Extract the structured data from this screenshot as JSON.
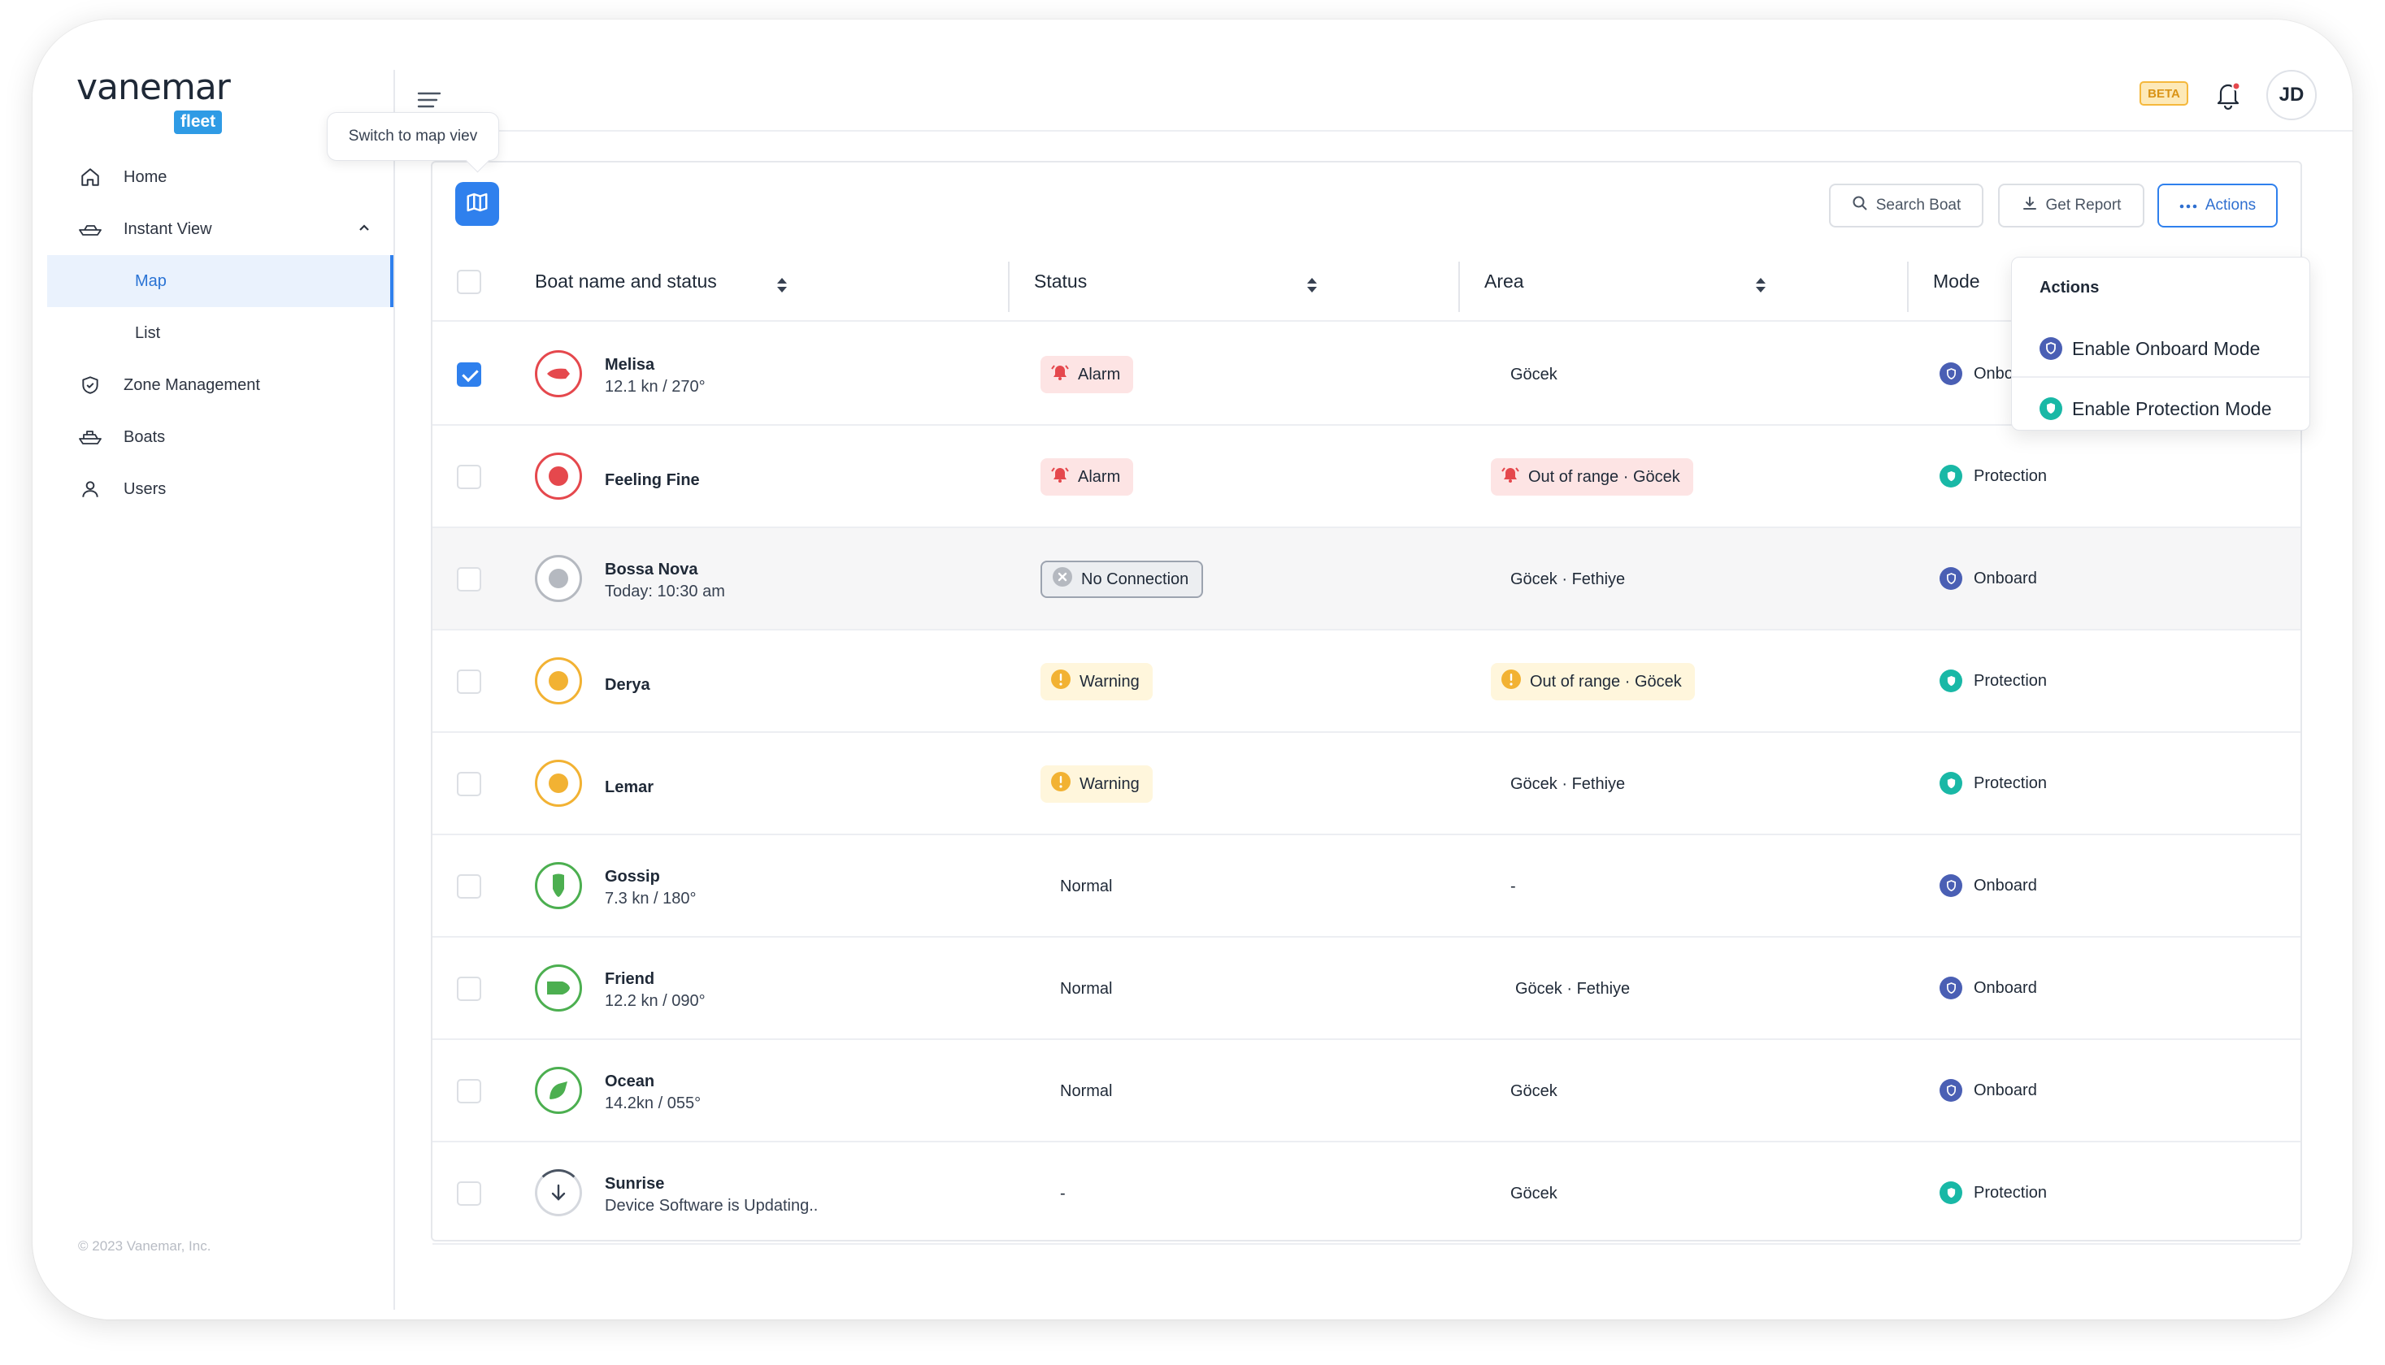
{
  "brand": {
    "name": "vanemar",
    "badge": "fleet"
  },
  "sidebar": {
    "items": [
      {
        "label": "Home",
        "icon": "home-icon"
      },
      {
        "label": "Instant View",
        "icon": "boat-icon",
        "expanded": true,
        "children": [
          {
            "label": "Map",
            "active": true
          },
          {
            "label": "List",
            "active": false
          }
        ]
      },
      {
        "label": "Zone Management",
        "icon": "shield-icon"
      },
      {
        "label": "Boats",
        "icon": "ship-icon"
      },
      {
        "label": "Users",
        "icon": "user-icon"
      }
    ],
    "copyright": "© 2023 Vanemar, Inc."
  },
  "topbar": {
    "tooltip": "Switch to map viev",
    "beta_label": "BETA",
    "avatar_initials": "JD"
  },
  "toolbar": {
    "search_label": "Search Boat",
    "report_label": "Get Report",
    "actions_label": "Actions"
  },
  "table": {
    "columns": {
      "boat": "Boat name and status",
      "status": "Status",
      "area": "Area",
      "mode": "Mode"
    },
    "rows": [
      {
        "name": "Melisa",
        "sub": "12.1 kn / 270°",
        "icon_color": "red",
        "checked": true,
        "status": "Alarm",
        "status_type": "alarm",
        "area": "Göcek",
        "area_type": "plain",
        "mode": "Onboard"
      },
      {
        "name": "Feeling Fine",
        "sub": "",
        "icon_color": "red",
        "checked": false,
        "status": "Alarm",
        "status_type": "alarm",
        "area": "Out of range · Göcek",
        "area_type": "alarm",
        "mode": "Protection"
      },
      {
        "name": "Bossa Nova",
        "sub": "Today: 10:30 am",
        "icon_color": "gray",
        "checked": false,
        "status": "No Connection",
        "status_type": "nocon",
        "area": "Göcek · Fethiye",
        "area_type": "plain",
        "mode": "Onboard"
      },
      {
        "name": "Derya",
        "sub": "",
        "icon_color": "orange",
        "checked": false,
        "status": "Warning",
        "status_type": "warn",
        "area": "Out of range · Göcek",
        "area_type": "warn",
        "mode": "Protection"
      },
      {
        "name": "Lemar",
        "sub": "",
        "icon_color": "orange",
        "checked": false,
        "status": "Warning",
        "status_type": "warn",
        "area": "Göcek · Fethiye",
        "area_type": "plain",
        "mode": "Protection"
      },
      {
        "name": "Gossip",
        "sub": "7.3 kn / 180°",
        "icon_color": "green",
        "checked": false,
        "status": "Normal",
        "status_type": "plain",
        "area": "-",
        "area_type": "plain",
        "mode": "Onboard"
      },
      {
        "name": "Friend",
        "sub": "12.2 kn / 090°",
        "icon_color": "green",
        "checked": false,
        "status": "Normal",
        "status_type": "plain",
        "area": "Göcek · Fethiye",
        "area_type": "plain",
        "mode": "Onboard"
      },
      {
        "name": "Ocean",
        "sub": "14.2kn / 055°",
        "icon_color": "green",
        "checked": false,
        "status": "Normal",
        "status_type": "plain",
        "area": "Göcek",
        "area_type": "plain",
        "mode": "Onboard"
      },
      {
        "name": "Sunrise",
        "sub": "Device Software is Updating..",
        "icon_color": "updating",
        "checked": false,
        "status": "-",
        "status_type": "plain",
        "area": "Göcek",
        "area_type": "plain",
        "mode": "Protection"
      }
    ]
  },
  "actions_menu": {
    "title": "Actions",
    "items": [
      {
        "label": "Enable Onboard Mode",
        "icon": "onboard-mode-icon"
      },
      {
        "label": "Enable Protection Mode",
        "icon": "protection-mode-icon"
      }
    ]
  },
  "colors": {
    "accent": "#2f80ed",
    "alarm": "#e5484d",
    "warning": "#f2b233",
    "normal": "#4caf50",
    "onboard": "#4a5fb4",
    "protection": "#19b8a6"
  }
}
